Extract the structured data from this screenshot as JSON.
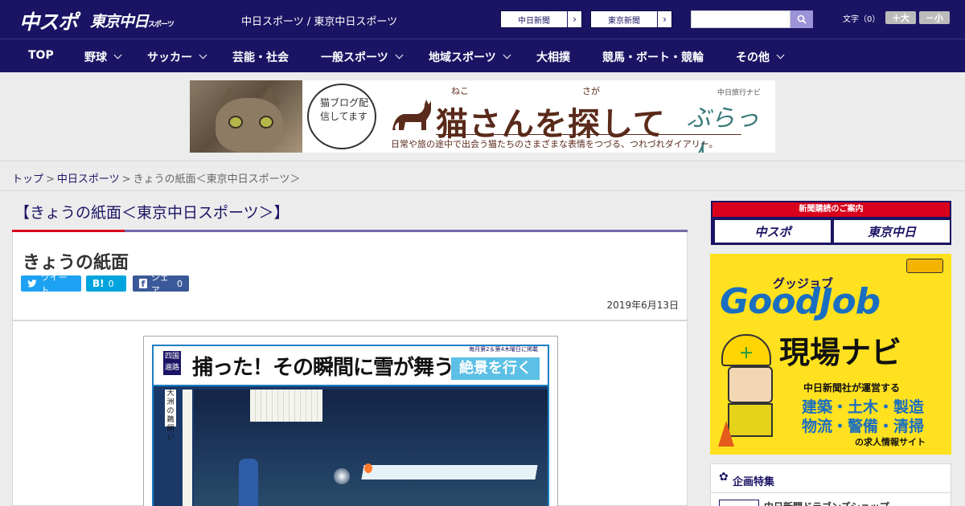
{
  "header": {
    "logo_main": "中スポ",
    "logo_sub": "東京中日",
    "logo_sub_small": "スポーツ",
    "site_title": "中日スポーツ / 東京中日スポーツ",
    "edition_buttons": [
      "中日新聞",
      "東京新聞"
    ],
    "search_placeholder": "",
    "font_size_label": "文字（0）",
    "font_larger": "＋大",
    "font_smaller": "－小"
  },
  "nav": {
    "items": [
      {
        "label": "TOP",
        "dropdown": false
      },
      {
        "label": "野球",
        "dropdown": true
      },
      {
        "label": "サッカー",
        "dropdown": true
      },
      {
        "label": "芸能・社会",
        "dropdown": false
      },
      {
        "label": "一般スポーツ",
        "dropdown": true
      },
      {
        "label": "地域スポーツ",
        "dropdown": true
      },
      {
        "label": "大相撲",
        "dropdown": false
      },
      {
        "label": "競馬・ボート・競輪",
        "dropdown": false
      },
      {
        "label": "その他",
        "dropdown": true
      }
    ]
  },
  "banner": {
    "bubble_text": "猫ブログ配信してます",
    "title": "猫さんを探して",
    "ruby1": "ねこ",
    "ruby2": "さが",
    "subtitle": "日常や旅の途中で出会う猫たちのさまざまな表情をつづる、つれづれダイアリー。",
    "tag": "中日旅行ナビ",
    "brand": "ぶらっ人"
  },
  "breadcrumb": {
    "items": [
      "トップ",
      "中日スポーツ"
    ],
    "current": "きょうの紙面＜東京中日スポーツ＞"
  },
  "main": {
    "section_title": "【きょうの紙面＜東京中日スポーツ＞】",
    "article_title": "きょうの紙面",
    "share": {
      "tweet": "ツイート",
      "hatena": "B!",
      "hatena_count": "0",
      "facebook": "シェア",
      "facebook_count": "0"
    },
    "date": "2019年6月13日"
  },
  "newspaper": {
    "corner": "四国遍路",
    "headline": "捕った！その瞬間に雪が舞う",
    "series": "絶景を行く",
    "tiny": "毎月第2＆第4木曜日に掲載",
    "side": "大洲の鵜飼い"
  },
  "sidebar": {
    "subscribe_head": "新聞購読のご案内",
    "subscribe_logos": [
      "中スポ",
      "東京中日"
    ],
    "goodjob": {
      "small": "グッジョブ",
      "big": "GoodJob",
      "navi": "現場ナビ",
      "line1": "中日新聞社が運営する",
      "line2": "建築・土木・製造",
      "line3": "物流・警備・清掃",
      "line4": "の求人情報サイト"
    },
    "feature_title": "企画特集",
    "feature_item": "中日新聞ドラゴンズショップ"
  }
}
